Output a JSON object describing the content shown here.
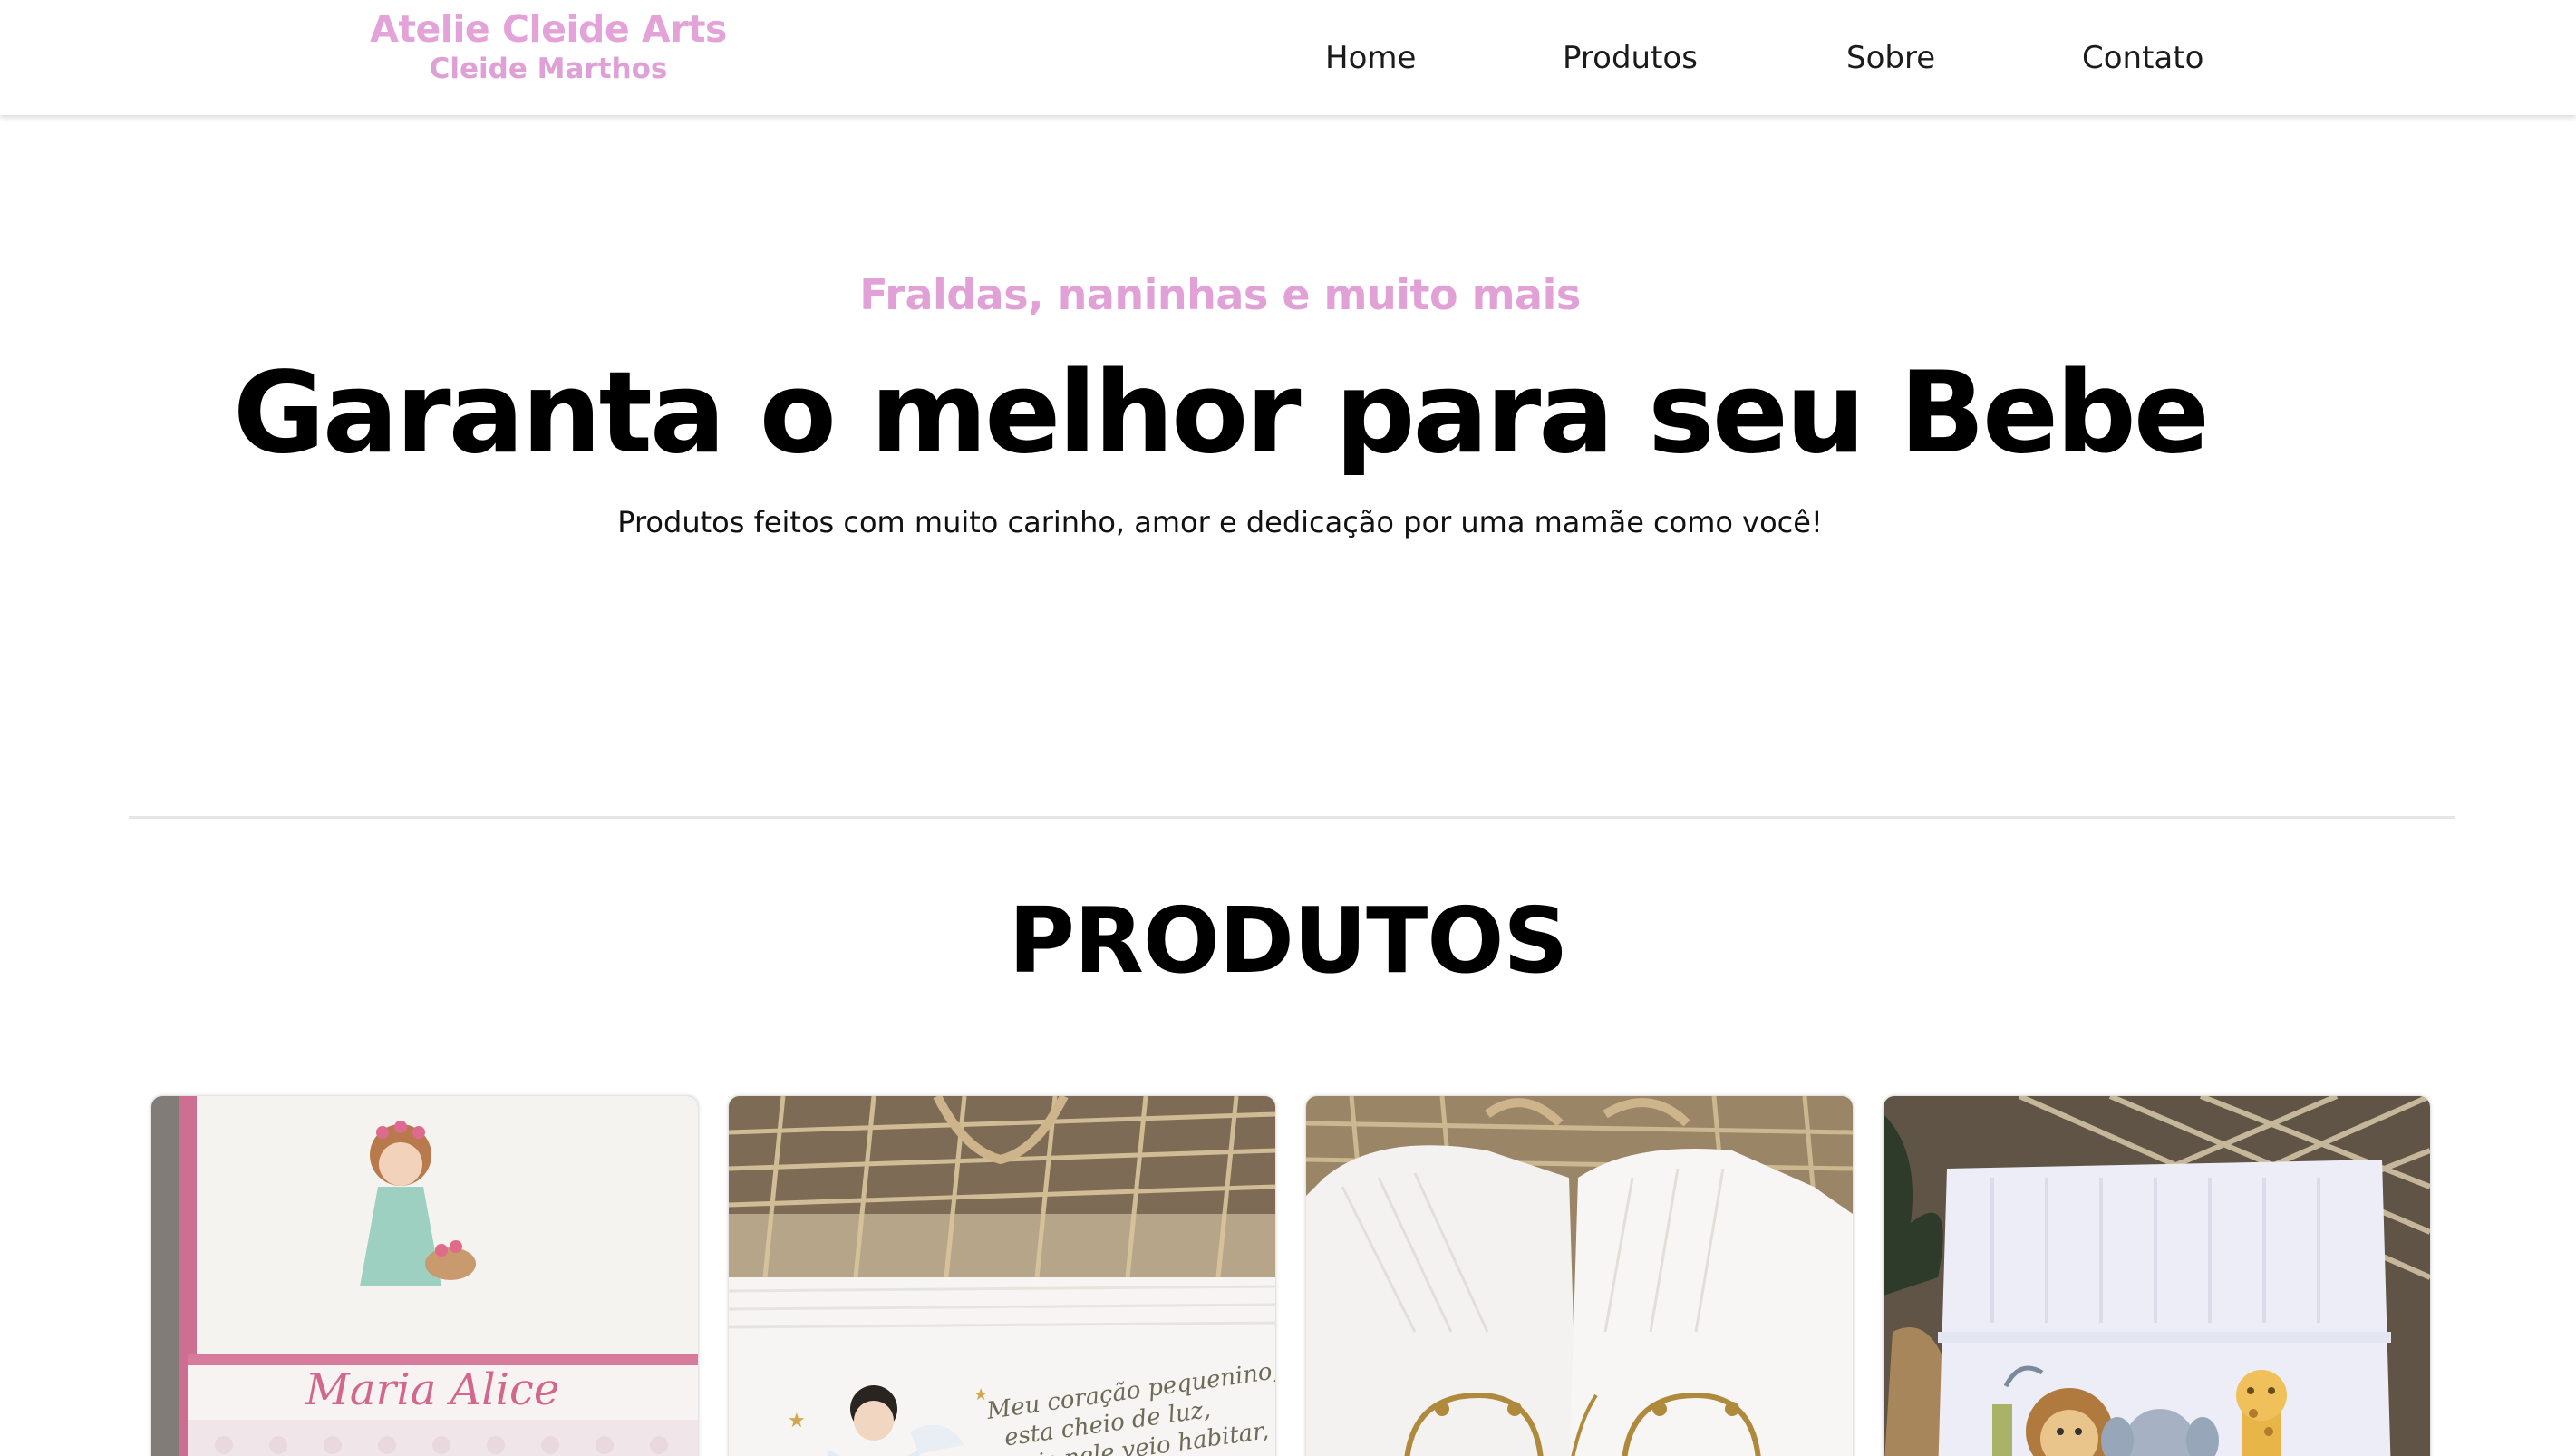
{
  "brand": {
    "title": "Atelie Cleide Arts",
    "subtitle": "Cleide Marthos",
    "color": "#e3a2d8"
  },
  "nav": {
    "items": [
      {
        "label": "Home"
      },
      {
        "label": "Produtos"
      },
      {
        "label": "Sobre"
      },
      {
        "label": "Contato"
      }
    ]
  },
  "hero": {
    "eyebrow": "Fraldas, naninhas e muito mais",
    "title": "Garanta o melhor para seu Bebe",
    "subtitle": "Produtos feitos com muito carinho, amor e dedicação por uma mamãe como você!"
  },
  "products": {
    "section_title": "PRODUTOS",
    "items": [
      {
        "image": "embroidered-burp-cloth-maria-alice",
        "embroidery_text": "Maria Alice"
      },
      {
        "image": "embroidered-cloth-angel-poem",
        "embroidery_lines": [
          "Meu coração pequenino,",
          "esta cheio de luz,",
          "pois nele veio habitar,"
        ]
      },
      {
        "image": "white-cloth-diapers-gold-embroidery"
      },
      {
        "image": "white-towel-safari-animals-embroidery"
      }
    ]
  },
  "colors": {
    "accent_pink": "#e3a2d8",
    "text_dark": "#111111",
    "divider": "#e6e6e6"
  }
}
